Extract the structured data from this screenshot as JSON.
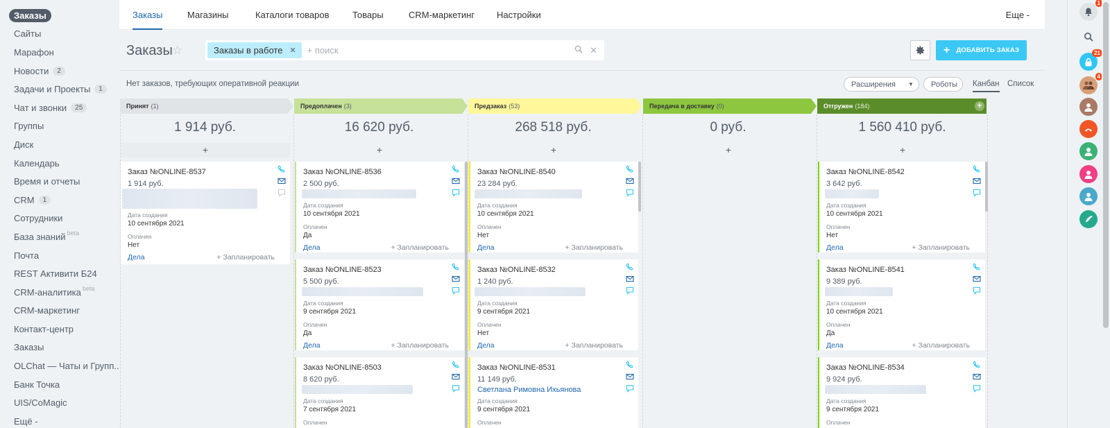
{
  "sidebar": {
    "items": [
      {
        "label": "Заказы",
        "active": true
      },
      {
        "label": "Сайты"
      },
      {
        "label": "Марафон"
      },
      {
        "label": "Новости",
        "count": "2"
      },
      {
        "label": "Задачи и Проекты",
        "count": "1"
      },
      {
        "label": "Чат и звонки",
        "count": "25"
      },
      {
        "label": "Группы"
      },
      {
        "label": "Диск"
      },
      {
        "label": "Календарь"
      },
      {
        "label": "Время и отчеты"
      },
      {
        "label": "CRM",
        "count": "1"
      },
      {
        "label": "Сотрудники"
      },
      {
        "label": "База знаний",
        "sup": "beta"
      },
      {
        "label": "Почта"
      },
      {
        "label": "REST Активити Б24"
      },
      {
        "label": "CRM-аналитика",
        "sup": "beta"
      },
      {
        "label": "CRM-маркетинг"
      },
      {
        "label": "Контакт-центр"
      },
      {
        "label": "Заказы"
      },
      {
        "label": "OLChat — Чаты и Групп..."
      },
      {
        "label": "Банк Точка"
      },
      {
        "label": "UIS/CoMagic"
      },
      {
        "label": "Ещё -"
      }
    ]
  },
  "tabs": [
    {
      "label": "Заказы",
      "active": true
    },
    {
      "label": "Магазины"
    },
    {
      "label": "Каталоги товаров"
    },
    {
      "label": "Товары"
    },
    {
      "label": "CRM-маркетинг"
    },
    {
      "label": "Настройки"
    }
  ],
  "tab_more": "Еще -",
  "rightbar": {
    "notify_badge": "1",
    "lock_badge": "21",
    "group_badge": "4"
  },
  "header": {
    "title": "Заказы",
    "filter_chip": "Заказы в работе",
    "search_placeholder": "+ поиск",
    "add_button": "ДОБАВИТЬ ЗАКАЗ"
  },
  "toolbar": {
    "alert": "Нет заказов, требующих оперативной реакции",
    "extensions": "Расширения",
    "robots": "Роботы",
    "view_kanban": "Канбан",
    "view_list": "Список"
  },
  "columns": [
    {
      "name": "Принят",
      "count": "(1)",
      "sum": "1 914 руб.",
      "color": "#e1e4e7"
    },
    {
      "name": "Предоплачен",
      "count": "(3)",
      "sum": "16 620 руб.",
      "color": "#c6e198"
    },
    {
      "name": "Предзаказ",
      "count": "(53)",
      "sum": "268 518 руб.",
      "color": "#fff79a"
    },
    {
      "name": "Передача в доставку",
      "count": "(0)",
      "sum": "0 руб.",
      "color": "#8dc63f"
    },
    {
      "name": "Отгружен",
      "count": "(184)",
      "sum": "1 560 410 руб.",
      "color": "#5b8c2a"
    }
  ],
  "add_plus": "+",
  "card_labels": {
    "created": "Дата создания",
    "paid": "Оплачен",
    "deals": "Дела",
    "plan": "+ Запланировать"
  },
  "cards": {
    "c0": [
      {
        "title": "Заказ №ONLINE-8537",
        "price": "1 914 руб.",
        "date": "10 сентября 2021",
        "paid": "Нет"
      }
    ],
    "c1": [
      {
        "title": "Заказ №ONLINE-8536",
        "price": "2 500 руб.",
        "date": "10 сентября 2021",
        "paid": "Да"
      },
      {
        "title": "Заказ №ONLINE-8523",
        "price": "5 500 руб.",
        "date": "9 сентября 2021",
        "paid": "Да"
      },
      {
        "title": "Заказ №ONLINE-8503",
        "price": "8 620 руб.",
        "date": "7 сентября 2021",
        "paid": ""
      }
    ],
    "c2": [
      {
        "title": "Заказ №ONLINE-8540",
        "price": "23 284 руб.",
        "date": "10 сентября 2021",
        "paid": "Нет"
      },
      {
        "title": "Заказ №ONLINE-8532",
        "price": "1 240 руб.",
        "date": "9 сентября 2021",
        "paid": "Нет"
      },
      {
        "title": "Заказ №ONLINE-8531",
        "price": "11 149 руб.",
        "client": "Светлана Римовна Ихьянова",
        "date": "9 сентября 2021",
        "paid": ""
      }
    ],
    "c4": [
      {
        "title": "Заказ №ONLINE-8542",
        "price": "3 642 руб.",
        "date": "10 сентября 2021",
        "paid": "Нет"
      },
      {
        "title": "Заказ №ONLINE-8541",
        "price": "9 389 руб.",
        "date": "10 сентября 2021",
        "paid": "Да"
      },
      {
        "title": "Заказ №ONLINE-8534",
        "price": "9 924 руб.",
        "date": "9 сентября 2021",
        "paid": ""
      }
    ]
  }
}
